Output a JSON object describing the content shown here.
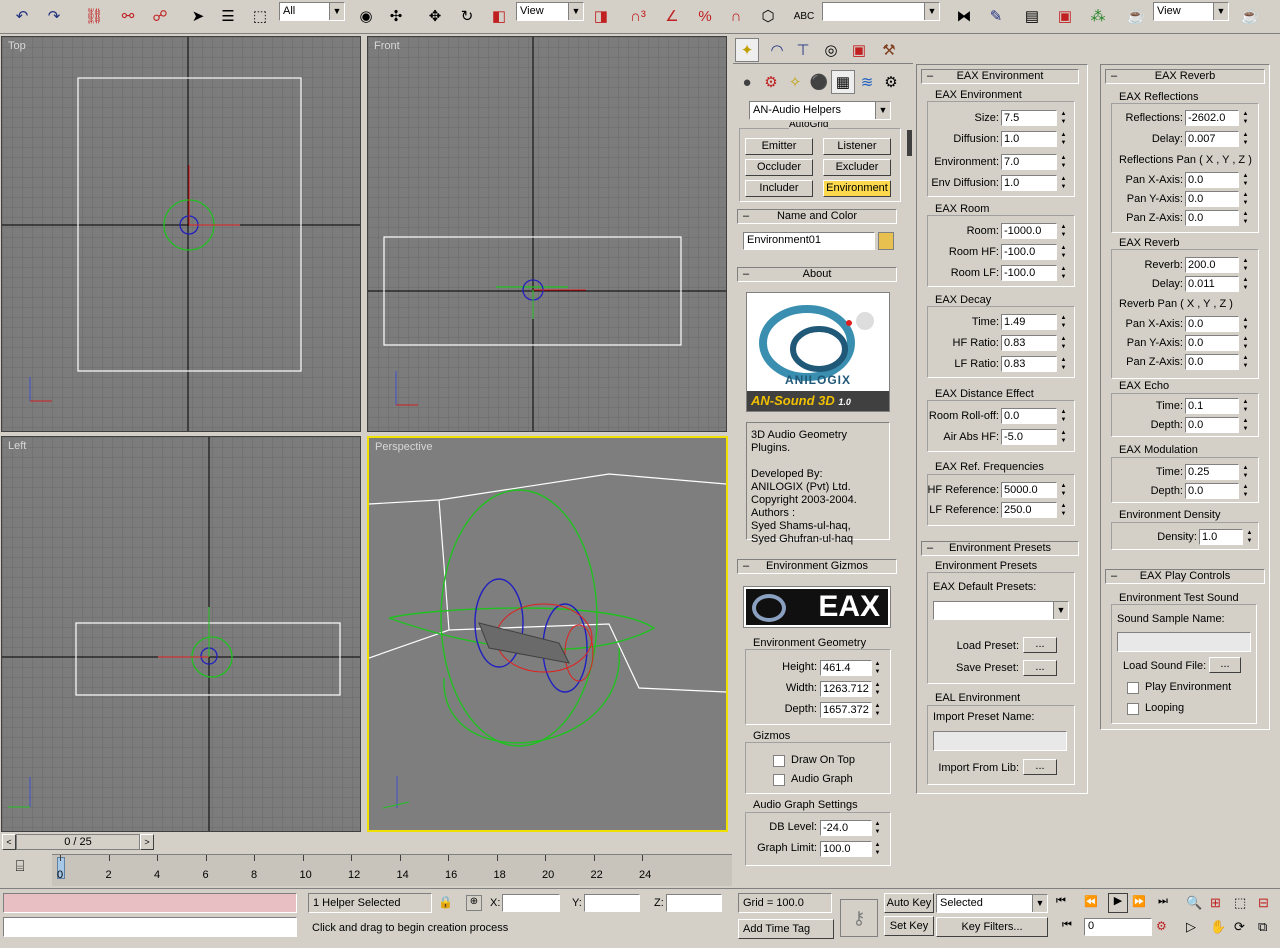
{
  "toolbar": {
    "selection_filter": "All",
    "ref_coord": "View",
    "named_selection": "",
    "render_view": "View",
    "icons": [
      "undo-icon",
      "redo-icon",
      "select-link-icon",
      "unlink-icon",
      "bind-spacewarp-icon",
      "select-icon",
      "select-by-name-icon",
      "rect-region-icon",
      "window-crossing-icon",
      "move-icon",
      "rotate-icon",
      "scale-icon",
      "pivot-icon",
      "snap-3d-icon",
      "angle-snap-icon",
      "percent-snap-icon",
      "spinner-snap-icon",
      "named-selection-icon",
      "mirror-icon",
      "align-icon",
      "track-view-icon",
      "schematic-icon",
      "material-editor-icon",
      "render-scene-icon",
      "quick-render-icon"
    ]
  },
  "viewports": {
    "top": {
      "label": "Top"
    },
    "front": {
      "label": "Front"
    },
    "left": {
      "label": "Left"
    },
    "perspective": {
      "label": "Perspective"
    }
  },
  "create_panel": {
    "category": "AN-Audio Helpers",
    "autogrid_label": "AutoGrid",
    "buttons": [
      {
        "label": "Emitter",
        "active": false
      },
      {
        "label": "Listener",
        "active": false
      },
      {
        "label": "Occluder",
        "active": false
      },
      {
        "label": "Excluder",
        "active": false
      },
      {
        "label": "Includer",
        "active": false
      },
      {
        "label": "Environment",
        "active": true
      }
    ],
    "name_color": {
      "title": "Name and Color",
      "name": "Environment01",
      "color": "#e8c050"
    },
    "about": {
      "title": "About",
      "logo_brand": "ANILOGIX",
      "logo_product": "AN-Sound 3D",
      "logo_version": "1.0",
      "description": "3D Audio Geometry Plugins.",
      "developed_by": "Developed By:",
      "company": "ANILOGIX (Pvt) Ltd.",
      "copyright": "Copyright 2003-2004.",
      "authors_label": "Authors :",
      "author1": "Syed Shams-ul-haq,",
      "author2": "Syed Ghufran-ul-haq"
    },
    "gizmos": {
      "title": "Environment Gizmos",
      "eax_logo": "EAX",
      "geometry_title": "Environment Geometry",
      "height_label": "Height:",
      "height": "461.4",
      "width_label": "Width:",
      "width": "1263.712",
      "depth_label": "Depth:",
      "depth": "1657.372",
      "gizmos_title": "Gizmos",
      "draw_on_top": "Draw On Top",
      "audio_graph": "Audio Graph",
      "graph_settings_title": "Audio Graph Settings",
      "db_level_label": "DB Level:",
      "db_level": "-24.0",
      "graph_limit_label": "Graph Limit:",
      "graph_limit": "100.0"
    }
  },
  "eax_env": {
    "title": "EAX Environment",
    "g1": "EAX Environment",
    "size_label": "Size:",
    "size": "7.5",
    "diffusion_label": "Diffusion:",
    "diffusion": "1.0",
    "environment_label": "Environment:",
    "environment": "7.0",
    "env_diffusion_label": "Env Diffusion:",
    "env_diffusion": "1.0",
    "g2": "EAX Room",
    "room_label": "Room:",
    "room": "-1000.0",
    "room_hf_label": "Room HF:",
    "room_hf": "-100.0",
    "room_lf_label": "Room LF:",
    "room_lf": "-100.0",
    "g3": "EAX Decay",
    "time_label": "Time:",
    "time": "1.49",
    "hf_ratio_label": "HF Ratio:",
    "hf_ratio": "0.83",
    "lf_ratio_label": "LF Ratio:",
    "lf_ratio": "0.83",
    "g4": "EAX Distance Effect",
    "rolloff_label": "Room Roll-off:",
    "rolloff": "0.0",
    "airabs_label": "Air Abs HF:",
    "airabs": "-5.0",
    "g5": "EAX Ref. Frequencies",
    "hfref_label": "HF Reference:",
    "hfref": "5000.0",
    "lfref_label": "LF Reference:",
    "lfref": "250.0"
  },
  "presets": {
    "title": "Environment Presets",
    "g1": "Environment Presets",
    "default_label": "EAX Default Presets:",
    "default_value": "",
    "load_label": "Load Preset:",
    "save_label": "Save Preset:",
    "dots": "...",
    "g2": "EAL Environment",
    "import_name_label": "Import Preset Name:",
    "import_name": "",
    "import_lib_label": "Import From Lib:"
  },
  "eax_reverb": {
    "title": "EAX Reverb",
    "g1": "EAX Reflections",
    "reflections_label": "Reflections:",
    "reflections": "-2602.0",
    "delay_label": "Delay:",
    "delay": "0.007",
    "pan_title": "Reflections Pan ( X , Y , Z )",
    "panx_label": "Pan X-Axis:",
    "panx": "0.0",
    "pany_label": "Pan Y-Axis:",
    "pany": "0.0",
    "panz_label": "Pan Z-Axis:",
    "panz": "0.0",
    "g2": "EAX Reverb",
    "reverb_label": "Reverb:",
    "reverb": "200.0",
    "rdelay_label": "Delay:",
    "rdelay": "0.011",
    "rpan_title": "Reverb Pan ( X , Y , Z )",
    "rpanx_label": "Pan X-Axis:",
    "rpanx": "0.0",
    "rpany_label": "Pan Y-Axis:",
    "rpany": "0.0",
    "rpanz_label": "Pan Z-Axis:",
    "rpanz": "0.0",
    "g3": "EAX Echo",
    "etime_label": "Time:",
    "etime": "0.1",
    "edepth_label": "Depth:",
    "edepth": "0.0",
    "g4": "EAX Modulation",
    "mtime_label": "Time:",
    "mtime": "0.25",
    "mdepth_label": "Depth:",
    "mdepth": "0.0",
    "g5": "Environment Density",
    "density_label": "Density:",
    "density": "1.0"
  },
  "play_controls": {
    "title": "EAX Play Controls",
    "g1": "Environment Test Sound",
    "sample_label": "Sound Sample Name:",
    "sample": "",
    "load_file_label": "Load Sound File:",
    "dots": "...",
    "play_env": "Play Environment",
    "looping": "Looping"
  },
  "timeline": {
    "frame": "0 / 25",
    "ticks": [
      "0",
      "2",
      "4",
      "6",
      "8",
      "10",
      "12",
      "14",
      "16",
      "18",
      "20",
      "22",
      "24"
    ]
  },
  "status": {
    "selected": "1 Helper Selected",
    "prompt": "Click and drag to begin creation process",
    "x_label": "X:",
    "y_label": "Y:",
    "z_label": "Z:",
    "x": "",
    "y": "",
    "z": "",
    "grid": "Grid = 100.0",
    "add_time_tag": "Add Time Tag",
    "auto_key": "Auto Key",
    "set_key": "Set Key",
    "key_mode": "Selected",
    "key_filters": "Key Filters...",
    "current_frame": "0"
  }
}
